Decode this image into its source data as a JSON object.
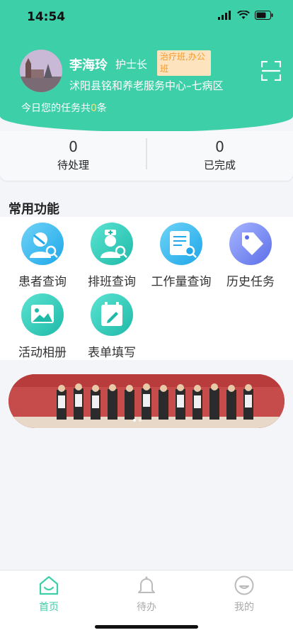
{
  "status_bar": {
    "time": "14:54"
  },
  "user": {
    "name": "李海玲",
    "role": "护士长",
    "shift_badge": "治疗班,办公班",
    "organization": "沭阳县铭和养老服务中心–七病区"
  },
  "tasks": {
    "prefix": "今日您的任务共",
    "count": "0",
    "suffix": "条"
  },
  "stats": [
    {
      "value": "0",
      "label": "待处理"
    },
    {
      "value": "0",
      "label": "已完成"
    }
  ],
  "functions": {
    "title": "常用功能",
    "items": [
      {
        "label": "患者查询",
        "icon": "patient-search-icon"
      },
      {
        "label": "排班查询",
        "icon": "schedule-search-icon"
      },
      {
        "label": "工作量查询",
        "icon": "workload-search-icon"
      },
      {
        "label": "历史任务",
        "icon": "tag-icon"
      },
      {
        "label": "活动相册",
        "icon": "photo-album-icon"
      },
      {
        "label": "表单填写",
        "icon": "form-edit-icon"
      }
    ]
  },
  "tabbar": {
    "items": [
      {
        "label": "首页",
        "icon": "home-icon",
        "active": true
      },
      {
        "label": "待办",
        "icon": "bell-icon",
        "active": false
      },
      {
        "label": "我的",
        "icon": "profile-icon",
        "active": false
      }
    ]
  },
  "colors": {
    "primary": "#3ccfa8",
    "badge_bg": "#fde4bf",
    "badge_text": "#f29a33",
    "count_highlight": "#f7e37a"
  }
}
